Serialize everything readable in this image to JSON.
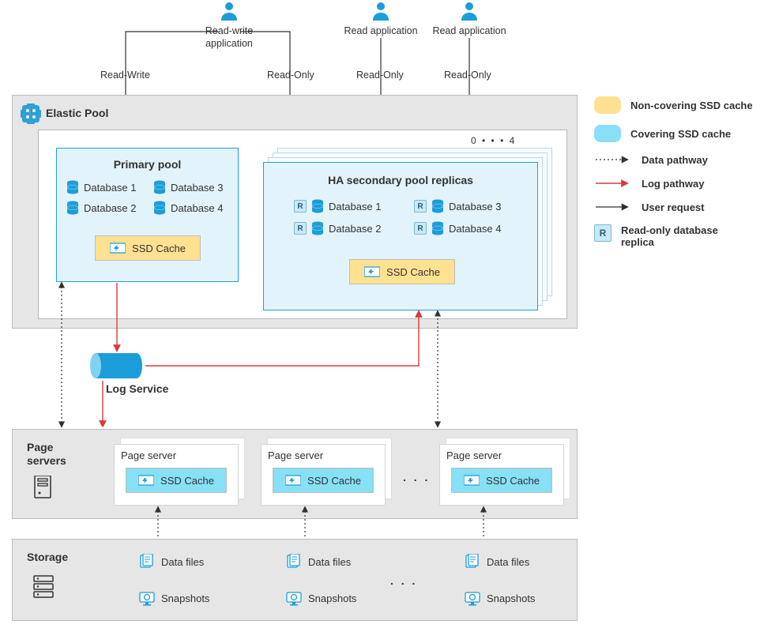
{
  "users": {
    "rw": {
      "label": "Read-write\napplication",
      "mode": "Read-Write",
      "mode2": "Read-Only"
    },
    "r1": {
      "label": "Read application",
      "mode": "Read-Only"
    },
    "r2": {
      "label": "Read application",
      "mode": "Read-Only"
    }
  },
  "elastic": {
    "title": "Elastic Pool",
    "primary": {
      "title": "Primary pool",
      "dbs": [
        "Database 1",
        "Database 2",
        "Database 3",
        "Database 4"
      ],
      "cache": "SSD Cache"
    },
    "secondary": {
      "title": "HA secondary pool replicas",
      "rangeStart": "0",
      "rangeEnd": "4",
      "dbs": [
        "Database 1",
        "Database 2",
        "Database 3",
        "Database 4"
      ],
      "cache": "SSD Cache"
    }
  },
  "log": {
    "label": "Log Service"
  },
  "pageServers": {
    "title": "Page servers",
    "card": "Page server",
    "cache": "SSD Cache"
  },
  "storage": {
    "title": "Storage",
    "datafiles": "Data files",
    "snapshots": "Snapshots"
  },
  "legend": {
    "noncov": "Non-covering SSD cache",
    "cov": "Covering SSD cache",
    "data": "Data pathway",
    "log": "Log pathway",
    "user": "User request",
    "ro": "Read-only database replica",
    "r": "R"
  },
  "ellipsis": ". . .",
  "dots3": ". . ."
}
